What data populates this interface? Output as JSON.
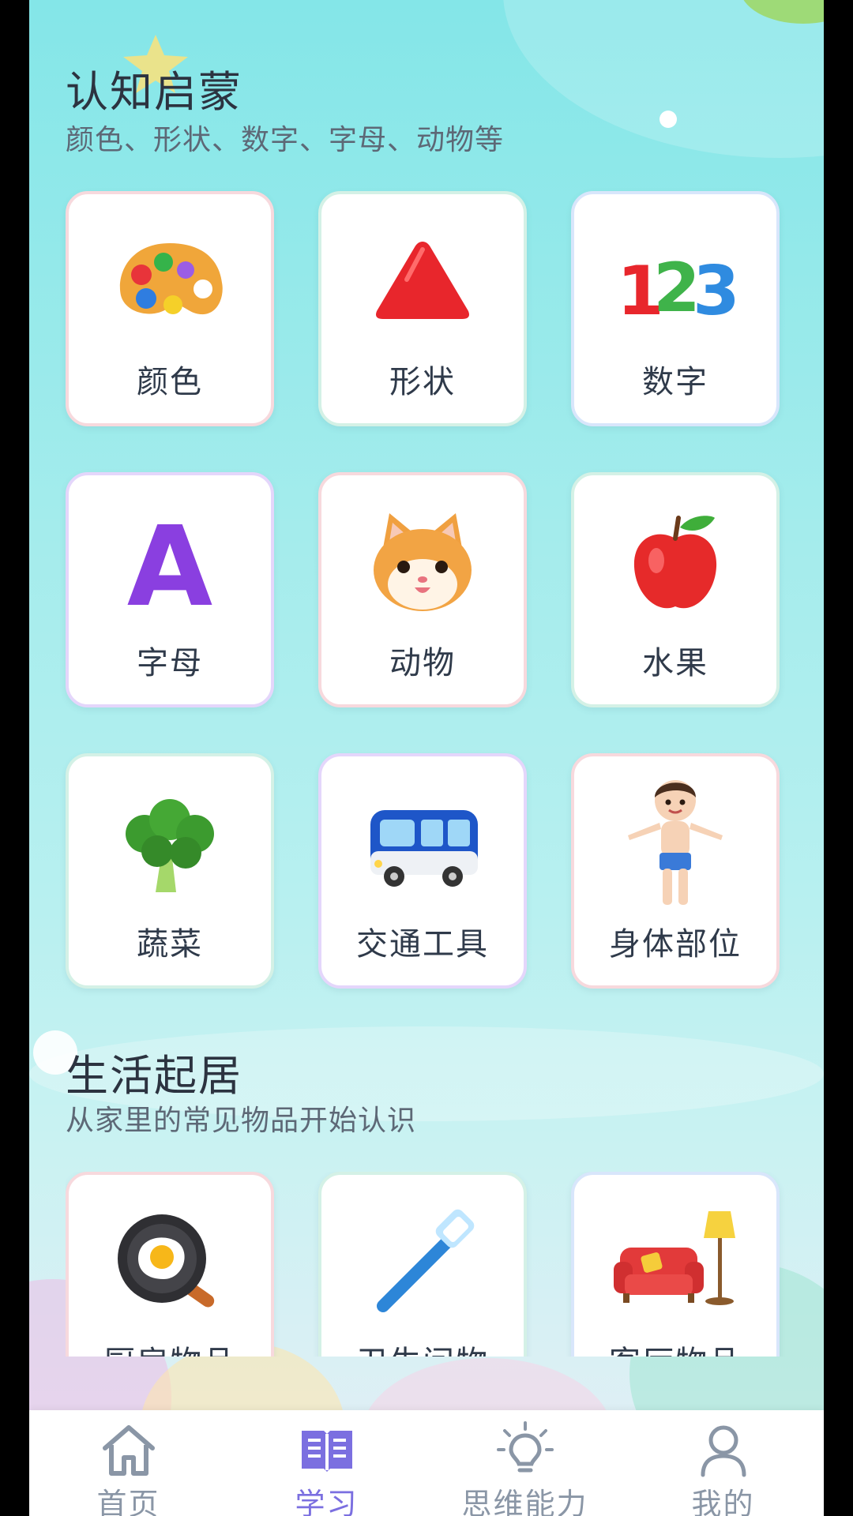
{
  "sections": [
    {
      "title": "认知启蒙",
      "subtitle": "颜色、形状、数字、字母、动物等",
      "cards": [
        {
          "label": "颜色",
          "icon": "palette-icon"
        },
        {
          "label": "形状",
          "icon": "triangle-icon"
        },
        {
          "label": "数字",
          "icon": "numbers-icon",
          "icon_text": "123"
        },
        {
          "label": "字母",
          "icon": "letter-a-icon",
          "icon_text": "A"
        },
        {
          "label": "动物",
          "icon": "cat-icon"
        },
        {
          "label": "水果",
          "icon": "apple-icon"
        },
        {
          "label": "蔬菜",
          "icon": "broccoli-icon"
        },
        {
          "label": "交通工具",
          "icon": "bus-icon"
        },
        {
          "label": "身体部位",
          "icon": "boy-icon"
        }
      ]
    },
    {
      "title": "生活起居",
      "subtitle": "从家里的常见物品开始认识",
      "cards": [
        {
          "label": "厨房物品",
          "icon": "frying-pan-icon"
        },
        {
          "label": "卫生间物",
          "icon": "toothbrush-icon"
        },
        {
          "label": "客厅物品",
          "icon": "sofa-lamp-icon"
        }
      ]
    }
  ],
  "bottom_nav": {
    "tabs": [
      {
        "label": "首页",
        "icon": "home-icon",
        "active": false
      },
      {
        "label": "学习",
        "icon": "book-icon",
        "active": true
      },
      {
        "label": "思维能力",
        "icon": "lightbulb-icon",
        "active": false
      },
      {
        "label": "我的",
        "icon": "person-icon",
        "active": false
      }
    ]
  },
  "colors": {
    "active_tab": "#7b6fe0",
    "inactive_tab": "#8a96a6",
    "title_text": "#2c3340",
    "background_top": "#84e6e8"
  }
}
